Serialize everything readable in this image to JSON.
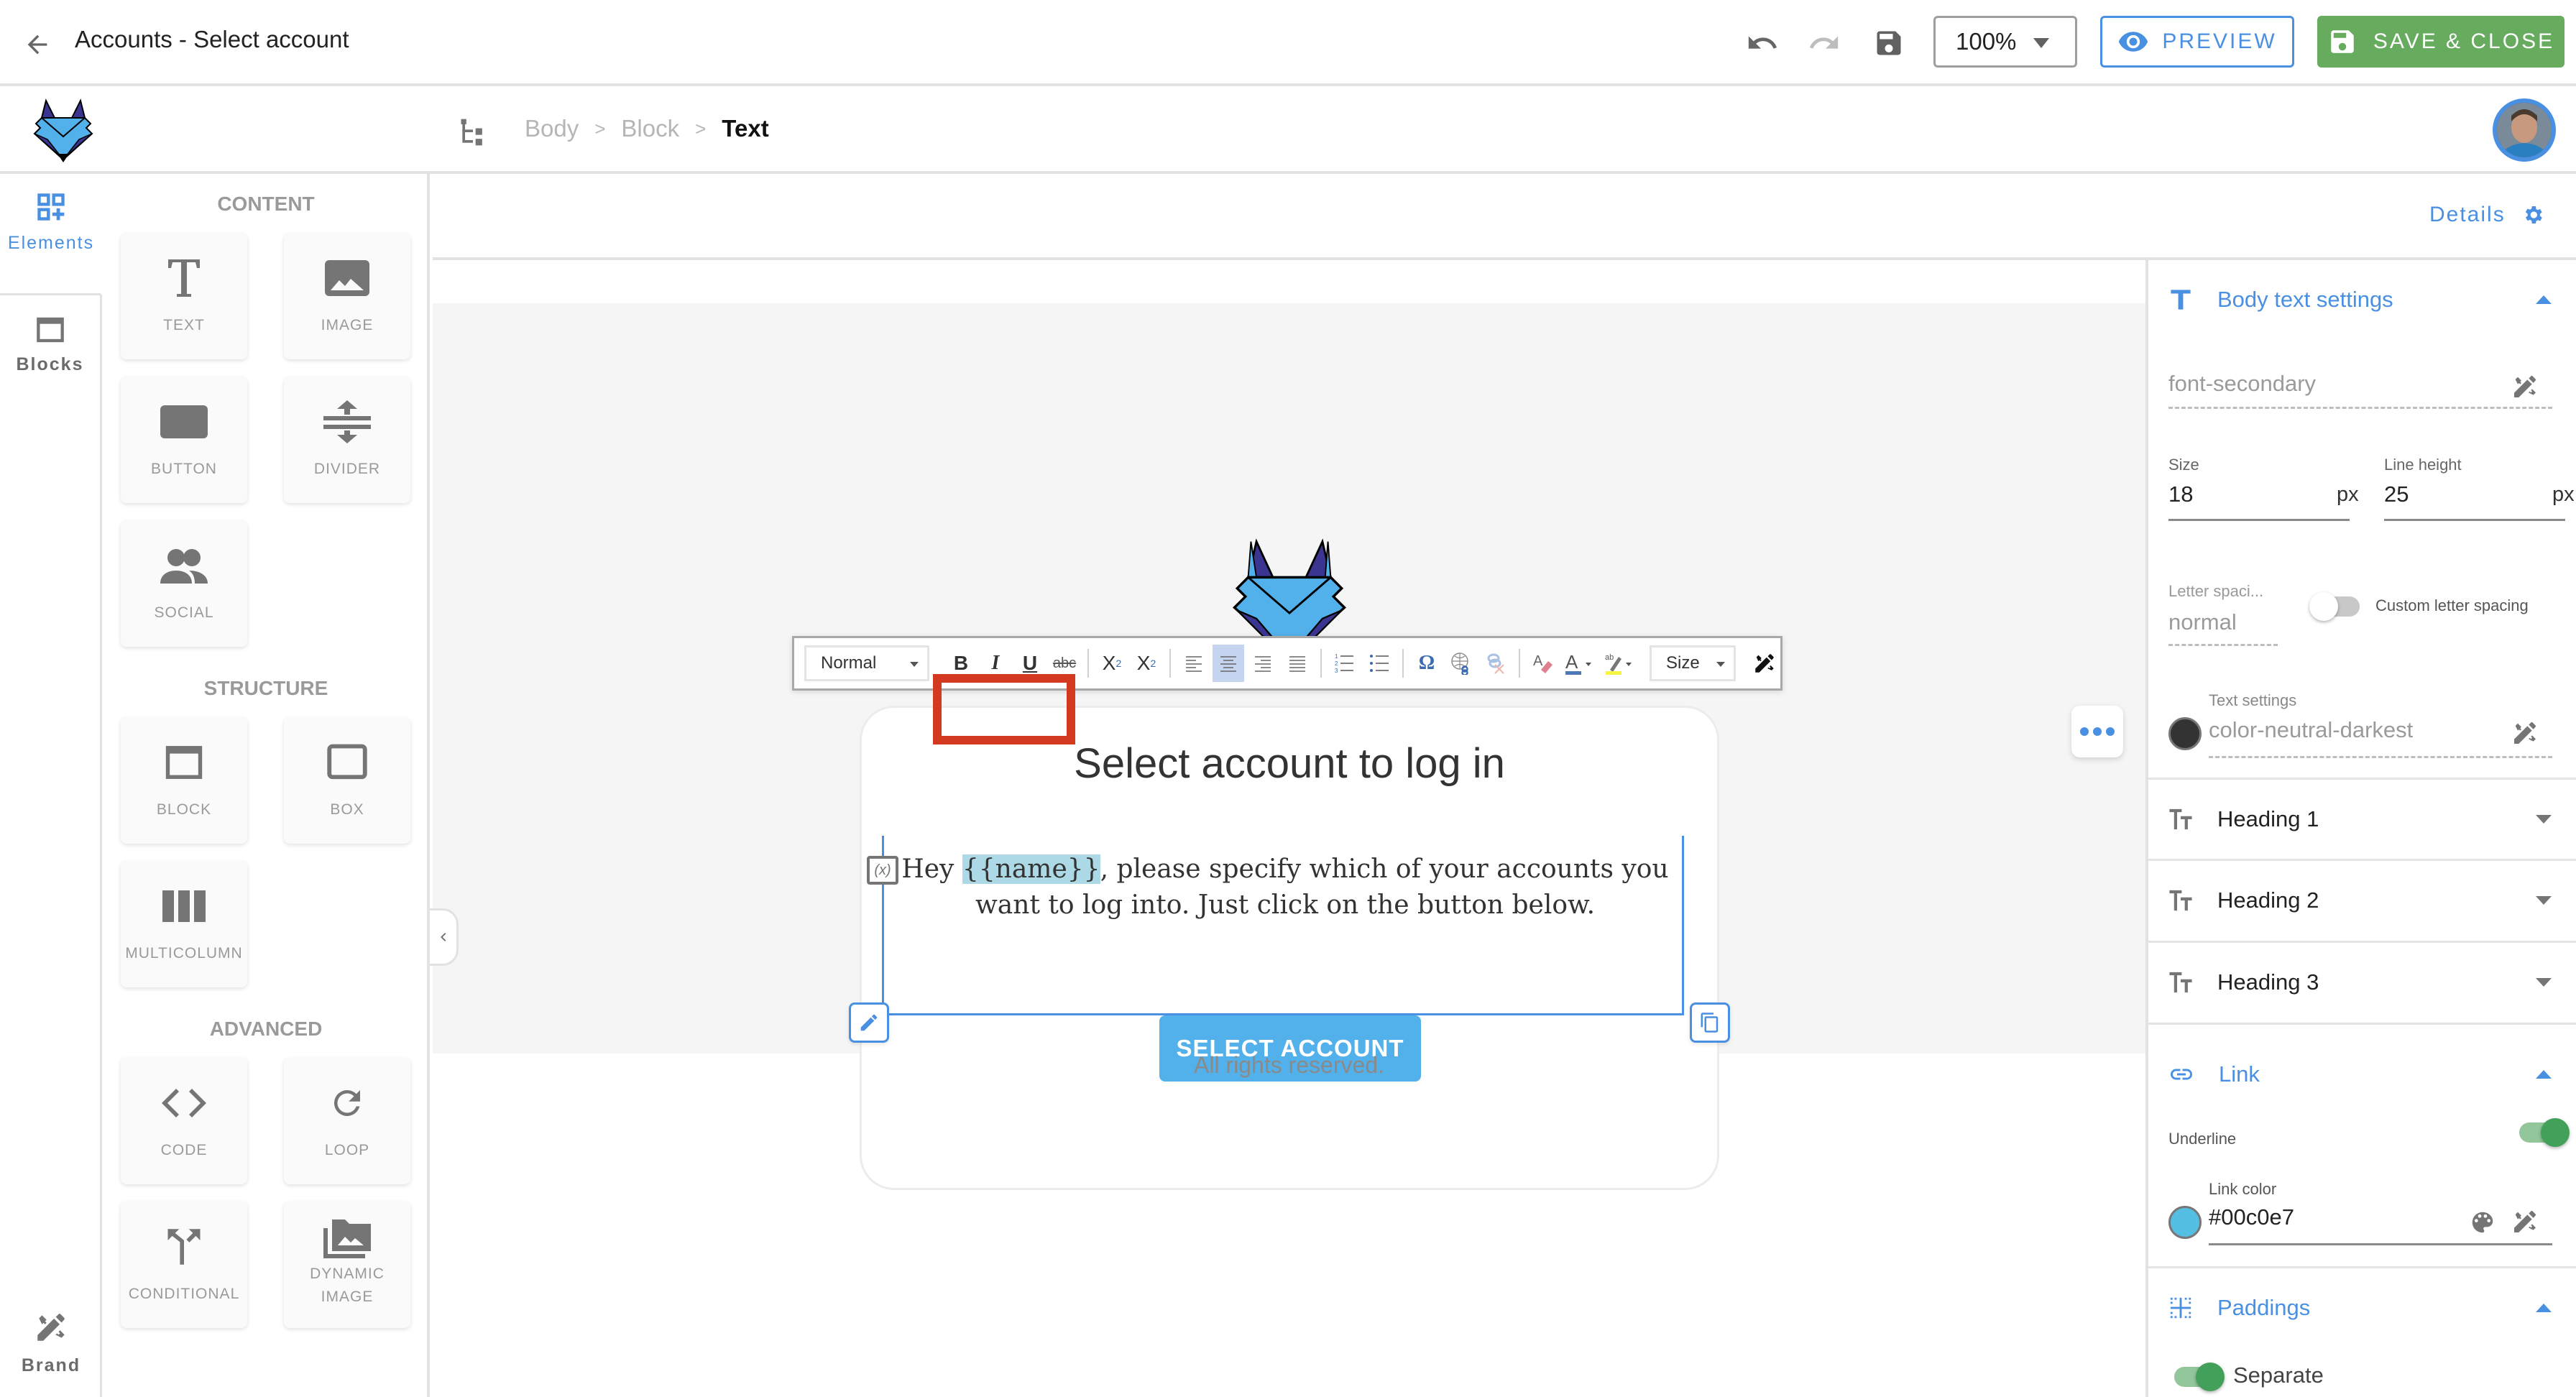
{
  "topbar": {
    "title": "Accounts - Select account",
    "zoom_value": "100%",
    "preview_label": "PREVIEW",
    "save_close_label": "SAVE & CLOSE",
    "icons": [
      "back-arrow-icon",
      "undo-icon",
      "redo-icon",
      "save-icon"
    ]
  },
  "breadcrumb": {
    "items": [
      "Body",
      "Block",
      "Text"
    ],
    "separator": ">"
  },
  "left_rail": {
    "tabs": [
      {
        "label": "Elements",
        "icon": "add-elements-icon",
        "active": true
      },
      {
        "label": "Blocks",
        "icon": "block-icon",
        "active": false
      }
    ],
    "brand_label": "Brand"
  },
  "elements_panel": {
    "sections": [
      {
        "heading": "CONTENT",
        "items": [
          {
            "label": "TEXT",
            "icon": "text-icon"
          },
          {
            "label": "IMAGE",
            "icon": "image-icon"
          },
          {
            "label": "BUTTON",
            "icon": "button-icon"
          },
          {
            "label": "DIVIDER",
            "icon": "divider-icon"
          },
          {
            "label": "SOCIAL",
            "icon": "social-icon"
          }
        ]
      },
      {
        "heading": "STRUCTURE",
        "items": [
          {
            "label": "BLOCK",
            "icon": "block-icon"
          },
          {
            "label": "BOX",
            "icon": "box-icon"
          },
          {
            "label": "MULTICOLUMN",
            "icon": "multicolumn-icon"
          }
        ]
      },
      {
        "heading": "ADVANCED",
        "items": [
          {
            "label": "CODE",
            "icon": "code-icon"
          },
          {
            "label": "LOOP",
            "icon": "loop-icon"
          },
          {
            "label": "CONDITIONAL",
            "icon": "conditional-icon"
          },
          {
            "label": "DYNAMIC IMAGE",
            "icon": "dynamic-image-icon"
          }
        ]
      }
    ]
  },
  "canvas": {
    "details_label": "Details",
    "email": {
      "heading": "Select account to log in",
      "body_before": "Hey ",
      "body_variable": "{{name}}",
      "body_after": ", please specify which of your accounts you want to log into. Just click on the button below.",
      "button_label": "SELECT ACCOUNT",
      "footer": "All rights reserved."
    },
    "rte_toolbar": {
      "format_value": "Normal",
      "size_value": "Size",
      "buttons": [
        "bold",
        "italic",
        "underline",
        "strikethrough",
        "subscript",
        "superscript",
        "align-left",
        "align-center",
        "align-right",
        "justify",
        "numbered-list",
        "bulleted-list",
        "special-char",
        "link",
        "unlink",
        "remove-format",
        "text-color",
        "background-color",
        "brand-tools"
      ],
      "active_button": "align-center",
      "bold_label": "B",
      "italic_label": "I",
      "underline_label": "U",
      "strike_label": "abc",
      "sub_label": "X",
      "sup_label": "X",
      "omega_label": "Ω",
      "text_color_label": "A",
      "variable_icon_label": "(x)"
    }
  },
  "right_panel": {
    "body_text_settings": {
      "title": "Body text settings",
      "expanded": true,
      "font_value": "font-secondary",
      "size_label": "Size",
      "size_value": "18",
      "size_unit": "px",
      "line_height_label": "Line height",
      "line_height_value": "25",
      "line_height_unit": "px",
      "letter_spacing_label": "Letter spaci...",
      "letter_spacing_value": "normal",
      "custom_letter_spacing_label": "Custom letter spacing",
      "custom_letter_spacing_on": false,
      "text_settings_label": "Text settings",
      "text_color_value": "color-neutral-darkest",
      "text_color_swatch": "#333333"
    },
    "headings": [
      {
        "label": "Heading 1",
        "expanded": false
      },
      {
        "label": "Heading 2",
        "expanded": false
      },
      {
        "label": "Heading 3",
        "expanded": false
      }
    ],
    "link": {
      "title": "Link",
      "expanded": true,
      "underline_label": "Underline",
      "underline_on": true,
      "link_color_label": "Link color",
      "link_color_value": "#00c0e7",
      "link_color_swatch": "#55bfe3"
    },
    "paddings": {
      "title": "Paddings",
      "expanded": true,
      "separate_label": "Separate",
      "separate_on": true
    }
  },
  "colors": {
    "accent": "#4a90e2",
    "save_green": "#66ab5e",
    "email_button": "#52b0ea",
    "annotation_red": "#d2391f",
    "variable_highlight": "#add8e6"
  }
}
